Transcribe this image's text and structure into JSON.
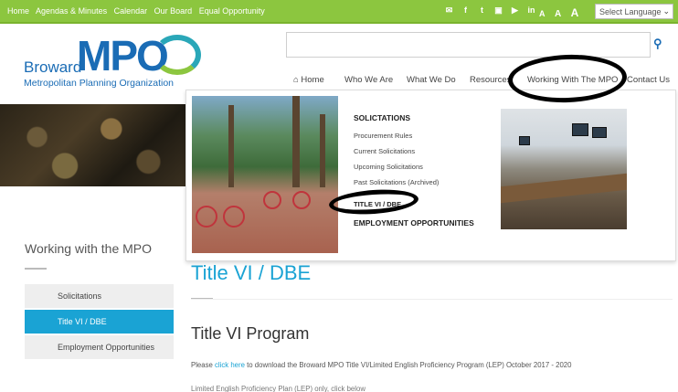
{
  "topbar": {
    "links": [
      "Home",
      "Agendas & Minutes",
      "Calendar",
      "Our Board",
      "Equal Opportunity"
    ],
    "social_icons": [
      "mail-icon",
      "facebook-icon",
      "twitter-icon",
      "flickr-icon",
      "youtube-icon",
      "linkedin-icon"
    ],
    "text_size": [
      "A",
      "A",
      "A"
    ],
    "language_select": "Select Language"
  },
  "logo": {
    "word1": "Broward",
    "word2": "MPO",
    "tagline": "Metropolitan Planning Organization"
  },
  "search": {
    "placeholder": ""
  },
  "nav": {
    "home": "Home",
    "items": [
      "Who We Are",
      "What We Do",
      "Resources",
      "Working With The MPO",
      "Contact Us"
    ]
  },
  "mega_menu": {
    "heading1": "SOLICTATIONS",
    "links": [
      "Procurement Rules",
      "Current Solicitations",
      "Upcoming Solicitations",
      "Past Solicitations (Archived)"
    ],
    "title_vi": "TITLE VI / DBE",
    "heading2": "EMPLOYMENT OPPORTUNITIES"
  },
  "sidebar": {
    "title": "Working with the MPO",
    "items": [
      "Solicitations",
      "Title VI / DBE",
      "Employment Opportunities"
    ]
  },
  "main": {
    "page_title": "Title VI / DBE",
    "section_heading": "Title VI Program",
    "para_prefix": "Please ",
    "para_link": "click here",
    "para_suffix": " to download the Broward MPO Title VI/Limited English Proficiency Program (LEP) October 2017 - 2020",
    "para2": "Limited English Proficiency Plan (LEP) only, click below"
  },
  "colors": {
    "topbar_green": "#8cc63f",
    "brand_blue": "#1a6cb5",
    "accent_cyan": "#1aa3d4"
  }
}
